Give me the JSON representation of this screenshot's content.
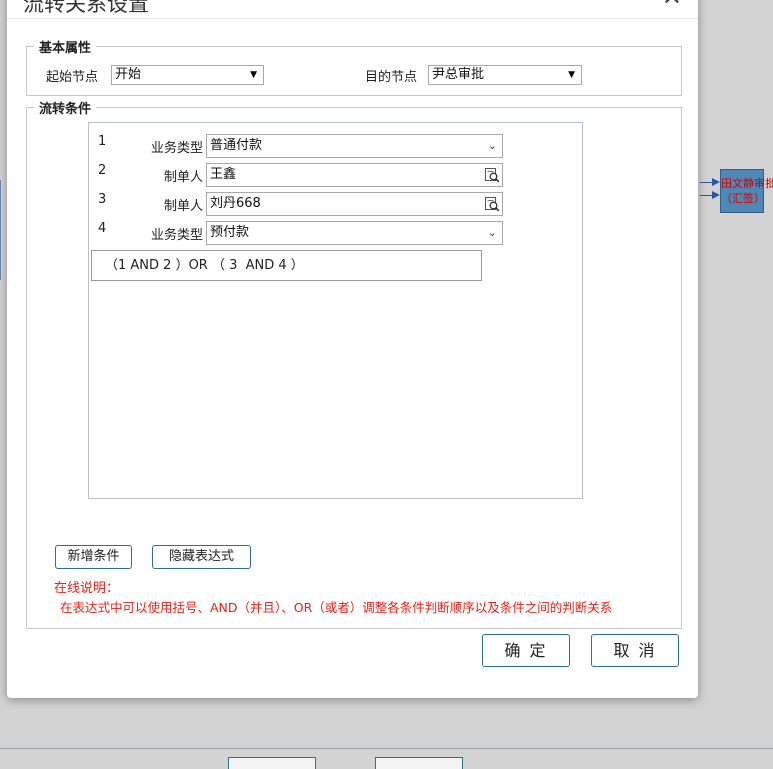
{
  "dialog": {
    "title": "流转关系设置",
    "close_glyph": "✕"
  },
  "basic": {
    "legend": "基本属性",
    "start_label": "起始节点",
    "start_value": "开始",
    "target_label": "目的节点",
    "target_value": "尹总审批"
  },
  "flow": {
    "legend": "流转条件",
    "conditions": [
      {
        "num": "1",
        "label": "业务类型",
        "value": "普通付款",
        "control": "select"
      },
      {
        "num": "2",
        "label": "制单人",
        "value": "王鑫",
        "control": "lookup"
      },
      {
        "num": "3",
        "label": "制单人",
        "value": "刘丹668",
        "control": "lookup"
      },
      {
        "num": "4",
        "label": "业务类型",
        "value": "预付款",
        "control": "select"
      }
    ],
    "expression": "（1 AND 2 ）OR （ 3  AND 4 ）",
    "add_button": "新增条件",
    "hide_expr_button": "隐藏表达式",
    "note_title": "在线说明：",
    "note_text": "在表达式中可以使用括号、AND（并且）、OR（或者）调整各条件判断顺序以及条件之间的判断关系"
  },
  "footer": {
    "ok_label": "确 定",
    "cancel_label": "取 消"
  },
  "background": {
    "node_label_line1": "田文静审批",
    "node_label_line2": "（汇签）"
  },
  "colors": {
    "accent_border": "#2f6f8f",
    "note_red": "#e2231a",
    "node_fill": "#4f88b5"
  },
  "icons": {
    "select_arrow": "▼",
    "chevron": "⌄",
    "lookup": "magnifier-doc-icon"
  }
}
